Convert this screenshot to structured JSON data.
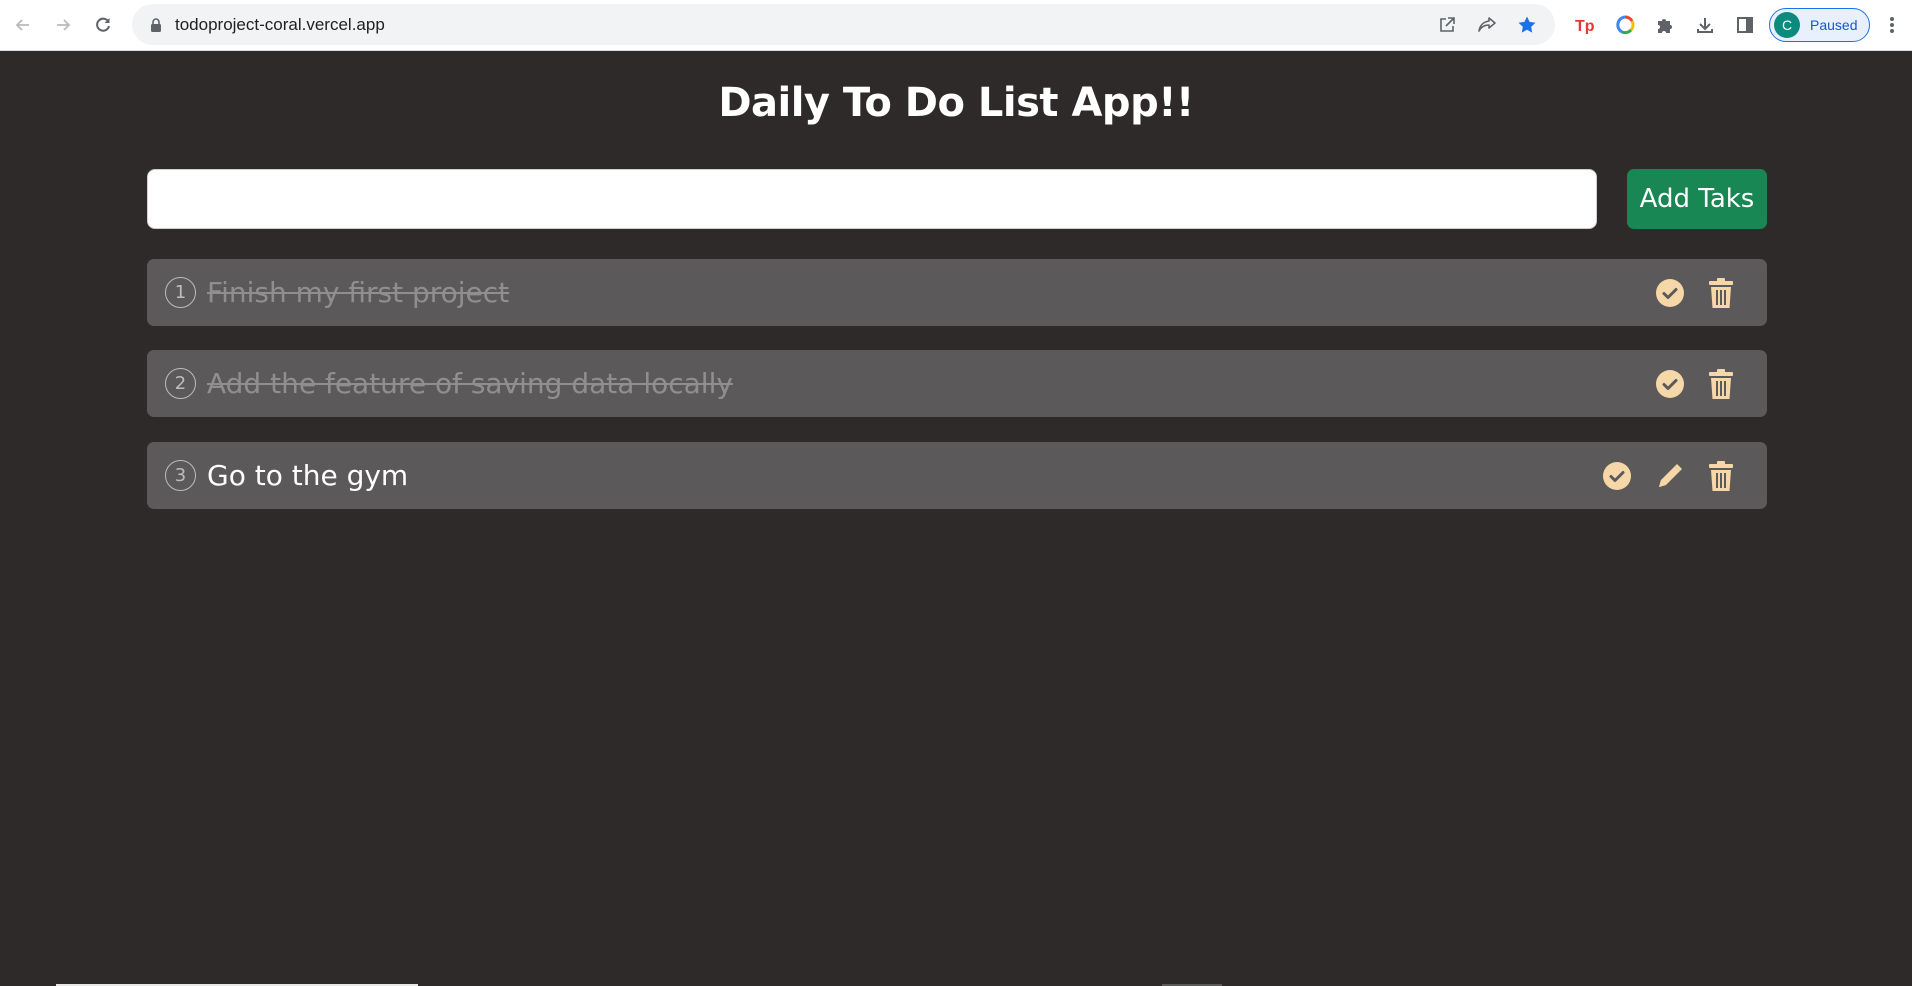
{
  "browser": {
    "url": "todoproject-coral.vercel.app",
    "profile_initial": "C",
    "profile_status": "Paused",
    "extensions": [
      "tp-extension-icon",
      "color-extension-icon",
      "puzzle-icon",
      "download-icon",
      "sidepanel-icon"
    ]
  },
  "app": {
    "title": "Daily To Do List App!!",
    "input": {
      "value": "",
      "placeholder": ""
    },
    "add_button_label": "Add Taks",
    "colors": {
      "background": "#2e2a2a",
      "row": "#5b5959",
      "accent": "#198754",
      "icon": "#f5d7a8"
    },
    "tasks": [
      {
        "number": "1",
        "text": "Finish my first project",
        "completed": true,
        "actions": [
          "check",
          "delete"
        ]
      },
      {
        "number": "2",
        "text": "Add the feature of saving data locally",
        "completed": true,
        "actions": [
          "check",
          "delete"
        ]
      },
      {
        "number": "3",
        "text": "Go to the gym",
        "completed": false,
        "actions": [
          "check",
          "edit",
          "delete"
        ]
      }
    ]
  }
}
